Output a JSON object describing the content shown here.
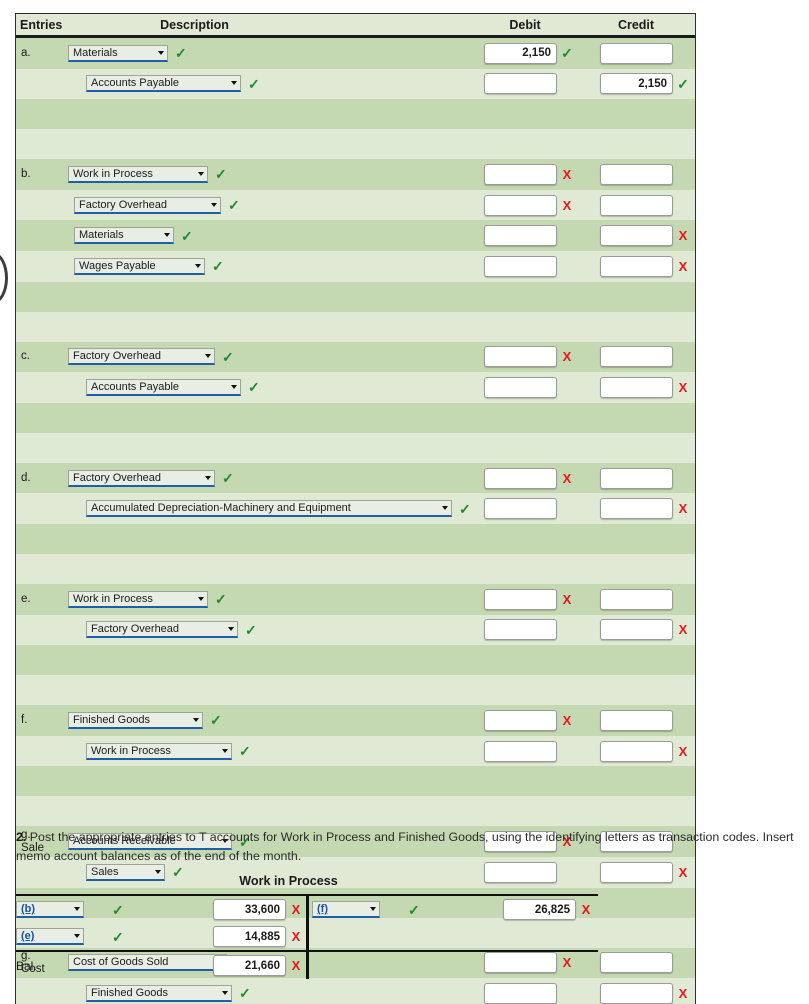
{
  "table": {
    "headers": {
      "entries": "Entries",
      "description": "Description",
      "debit": "Debit",
      "credit": "Credit"
    },
    "rows": [
      {
        "letter": "a.",
        "letter2": "",
        "indent": 0,
        "account": "Materials",
        "sel_width": 100,
        "debit": "2,150",
        "debit_mark": "ok",
        "credit": "",
        "credit_mark": "none",
        "acct_mark": "ok",
        "shade": "dark"
      },
      {
        "letter": "",
        "letter2": "",
        "indent": 18,
        "account": "Accounts Payable",
        "sel_width": 155,
        "debit": "",
        "debit_mark": "none",
        "credit": "2,150",
        "credit_mark": "ok",
        "acct_mark": "ok",
        "shade": "light"
      },
      {
        "spacer": true,
        "shade": "dark"
      },
      {
        "spacer": true,
        "shade": "light"
      },
      {
        "letter": "b.",
        "letter2": "",
        "indent": 0,
        "account": "Work in Process",
        "sel_width": 140,
        "debit": "",
        "debit_mark": "bad",
        "credit": "",
        "credit_mark": "none",
        "acct_mark": "ok",
        "shade": "dark"
      },
      {
        "letter": "",
        "letter2": "",
        "indent": 6,
        "account": "Factory Overhead",
        "sel_width": 147,
        "debit": "",
        "debit_mark": "bad",
        "credit": "",
        "credit_mark": "none",
        "acct_mark": "ok",
        "shade": "light"
      },
      {
        "letter": "",
        "letter2": "",
        "indent": 6,
        "account": "Materials",
        "sel_width": 100,
        "debit": "",
        "debit_mark": "none",
        "credit": "",
        "credit_mark": "bad",
        "acct_mark": "ok",
        "shade": "dark"
      },
      {
        "letter": "",
        "letter2": "",
        "indent": 6,
        "account": "Wages Payable",
        "sel_width": 131,
        "debit": "",
        "debit_mark": "none",
        "credit": "",
        "credit_mark": "bad",
        "acct_mark": "ok",
        "shade": "light"
      },
      {
        "spacer": true,
        "shade": "dark"
      },
      {
        "spacer": true,
        "shade": "light"
      },
      {
        "letter": "c.",
        "letter2": "",
        "indent": 0,
        "account": "Factory Overhead",
        "sel_width": 147,
        "debit": "",
        "debit_mark": "bad",
        "credit": "",
        "credit_mark": "none",
        "acct_mark": "ok",
        "shade": "dark"
      },
      {
        "letter": "",
        "letter2": "",
        "indent": 18,
        "account": "Accounts Payable",
        "sel_width": 155,
        "debit": "",
        "debit_mark": "none",
        "credit": "",
        "credit_mark": "bad",
        "acct_mark": "ok",
        "shade": "light"
      },
      {
        "spacer": true,
        "shade": "dark"
      },
      {
        "spacer": true,
        "shade": "light"
      },
      {
        "letter": "d.",
        "letter2": "",
        "indent": 0,
        "account": "Factory Overhead",
        "sel_width": 147,
        "debit": "",
        "debit_mark": "bad",
        "credit": "",
        "credit_mark": "none",
        "acct_mark": "ok",
        "shade": "dark"
      },
      {
        "letter": "",
        "letter2": "",
        "indent": 18,
        "account": "Accumulated Depreciation-Machinery and Equipment",
        "sel_width": 366,
        "debit": "",
        "debit_mark": "none",
        "credit": "",
        "credit_mark": "bad",
        "acct_mark": "ok",
        "shade": "light"
      },
      {
        "spacer": true,
        "shade": "dark"
      },
      {
        "spacer": true,
        "shade": "light"
      },
      {
        "letter": "e.",
        "letter2": "",
        "indent": 0,
        "account": "Work in Process",
        "sel_width": 140,
        "debit": "",
        "debit_mark": "bad",
        "credit": "",
        "credit_mark": "none",
        "acct_mark": "ok",
        "shade": "dark"
      },
      {
        "letter": "",
        "letter2": "",
        "indent": 18,
        "account": "Factory Overhead",
        "sel_width": 152,
        "debit": "",
        "debit_mark": "none",
        "credit": "",
        "credit_mark": "bad",
        "acct_mark": "ok",
        "shade": "light"
      },
      {
        "spacer": true,
        "shade": "dark"
      },
      {
        "spacer": true,
        "shade": "light"
      },
      {
        "letter": "f.",
        "letter2": "",
        "indent": 0,
        "account": "Finished Goods",
        "sel_width": 135,
        "debit": "",
        "debit_mark": "bad",
        "credit": "",
        "credit_mark": "none",
        "acct_mark": "ok",
        "shade": "dark"
      },
      {
        "letter": "",
        "letter2": "",
        "indent": 18,
        "account": "Work in Process",
        "sel_width": 146,
        "debit": "",
        "debit_mark": "none",
        "credit": "",
        "credit_mark": "bad",
        "acct_mark": "ok",
        "shade": "light"
      },
      {
        "spacer": true,
        "shade": "dark"
      },
      {
        "spacer": true,
        "shade": "light"
      },
      {
        "letter": "g.",
        "letter2": "Sale",
        "indent": 0,
        "account": "Accounts Receivable",
        "sel_width": 164,
        "debit": "",
        "debit_mark": "bad",
        "credit": "",
        "credit_mark": "none",
        "acct_mark": "ok",
        "shade": "dark"
      },
      {
        "letter": "",
        "letter2": "",
        "indent": 18,
        "account": "Sales",
        "sel_width": 79,
        "debit": "",
        "debit_mark": "none",
        "credit": "",
        "credit_mark": "bad",
        "acct_mark": "ok",
        "shade": "light"
      },
      {
        "spacer": true,
        "shade": "dark"
      },
      {
        "spacer": true,
        "shade": "light"
      },
      {
        "letter": "g.",
        "letter2": "Cost",
        "indent": 0,
        "account": "Cost of Goods Sold",
        "sel_width": 159,
        "debit": "",
        "debit_mark": "bad",
        "credit": "",
        "credit_mark": "none",
        "acct_mark": "ok",
        "shade": "dark"
      },
      {
        "letter": "",
        "letter2": "",
        "indent": 18,
        "account": "Finished Goods",
        "sel_width": 146,
        "debit": "",
        "debit_mark": "none",
        "credit": "",
        "credit_mark": "bad",
        "acct_mark": "ok",
        "shade": "light"
      }
    ]
  },
  "question2": {
    "number": "2.",
    "text": "Post the appropriate entries to T accounts for Work in Process and Finished Goods, using the identifying letters as transaction codes. Insert memo account balances as of the end of the month."
  },
  "taccount": {
    "title": "Work in Process",
    "debit_side": [
      {
        "code": "(b)",
        "code_mark": "ok",
        "amount": "33,600",
        "amount_mark": "bad"
      },
      {
        "code": "(e)",
        "code_mark": "ok",
        "amount": "14,885",
        "amount_mark": "bad"
      }
    ],
    "credit_side": [
      {
        "code": "(f)",
        "code_mark": "ok",
        "amount": "26,825",
        "amount_mark": "bad"
      }
    ],
    "balance": {
      "label": "Bal.",
      "amount": "21,660",
      "amount_mark": "bad"
    }
  },
  "icons": {
    "correct": "✓",
    "incorrect": "X",
    "dropdown_arrow": "chevron-down-icon"
  },
  "colors": {
    "row_light": "#dfe9d3",
    "row_dark": "#c4d8b2",
    "correct_green": "#1f8a2e",
    "incorrect_red": "#e8151b",
    "select_underline": "#1e5fa8",
    "link_blue": "#1551a8"
  }
}
